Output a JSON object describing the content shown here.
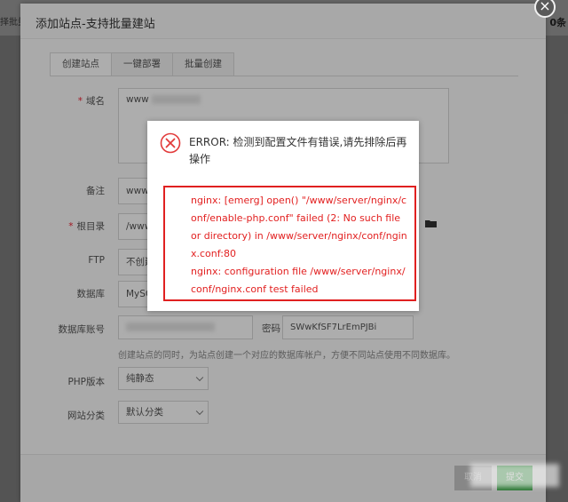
{
  "background": {
    "left_text": "择批量",
    "right_text": "0条"
  },
  "dialog": {
    "title": "添加站点-支持批量建站",
    "close_icon": "×",
    "tabs": [
      {
        "label": "创建站点",
        "active": true
      },
      {
        "label": "一键部署",
        "active": false
      },
      {
        "label": "批量创建",
        "active": false
      }
    ]
  },
  "form": {
    "domain": {
      "label": "域名",
      "value": "www"
    },
    "remark": {
      "label": "备注",
      "value": "www."
    },
    "root": {
      "label": "根目录",
      "value": "/www"
    },
    "ftp": {
      "label": "FTP",
      "value": "不创建"
    },
    "database": {
      "label": "数据库",
      "value": "MySQ"
    },
    "db_account": {
      "label": "数据库账号",
      "value": ""
    },
    "password": {
      "label": "密码",
      "value": "SWwKfSF7LrEmPJBi"
    },
    "hint": "创建站点的同时，为站点创建一个对应的数据库帐户，方便不同站点使用不同数据库。",
    "php": {
      "label": "PHP版本",
      "value": "纯静态"
    },
    "category": {
      "label": "网站分类",
      "value": "默认分类"
    }
  },
  "footer": {
    "cancel_label": "取消",
    "submit_label": "提交"
  },
  "error_popup": {
    "title": "ERROR: 检测到配置文件有错误,请先排除后再操作",
    "lines": [
      "nginx: [emerg] open() \"/www/server/nginx/conf/enable-php.conf\" failed (2: No such file or directory) in /www/server/nginx/conf/nginx.conf:80",
      "nginx: configuration file /www/server/nginx/conf/nginx.conf test failed"
    ]
  },
  "colors": {
    "error_red": "#e02020",
    "submit_green": "#3fae4c",
    "required_red": "#e23"
  }
}
